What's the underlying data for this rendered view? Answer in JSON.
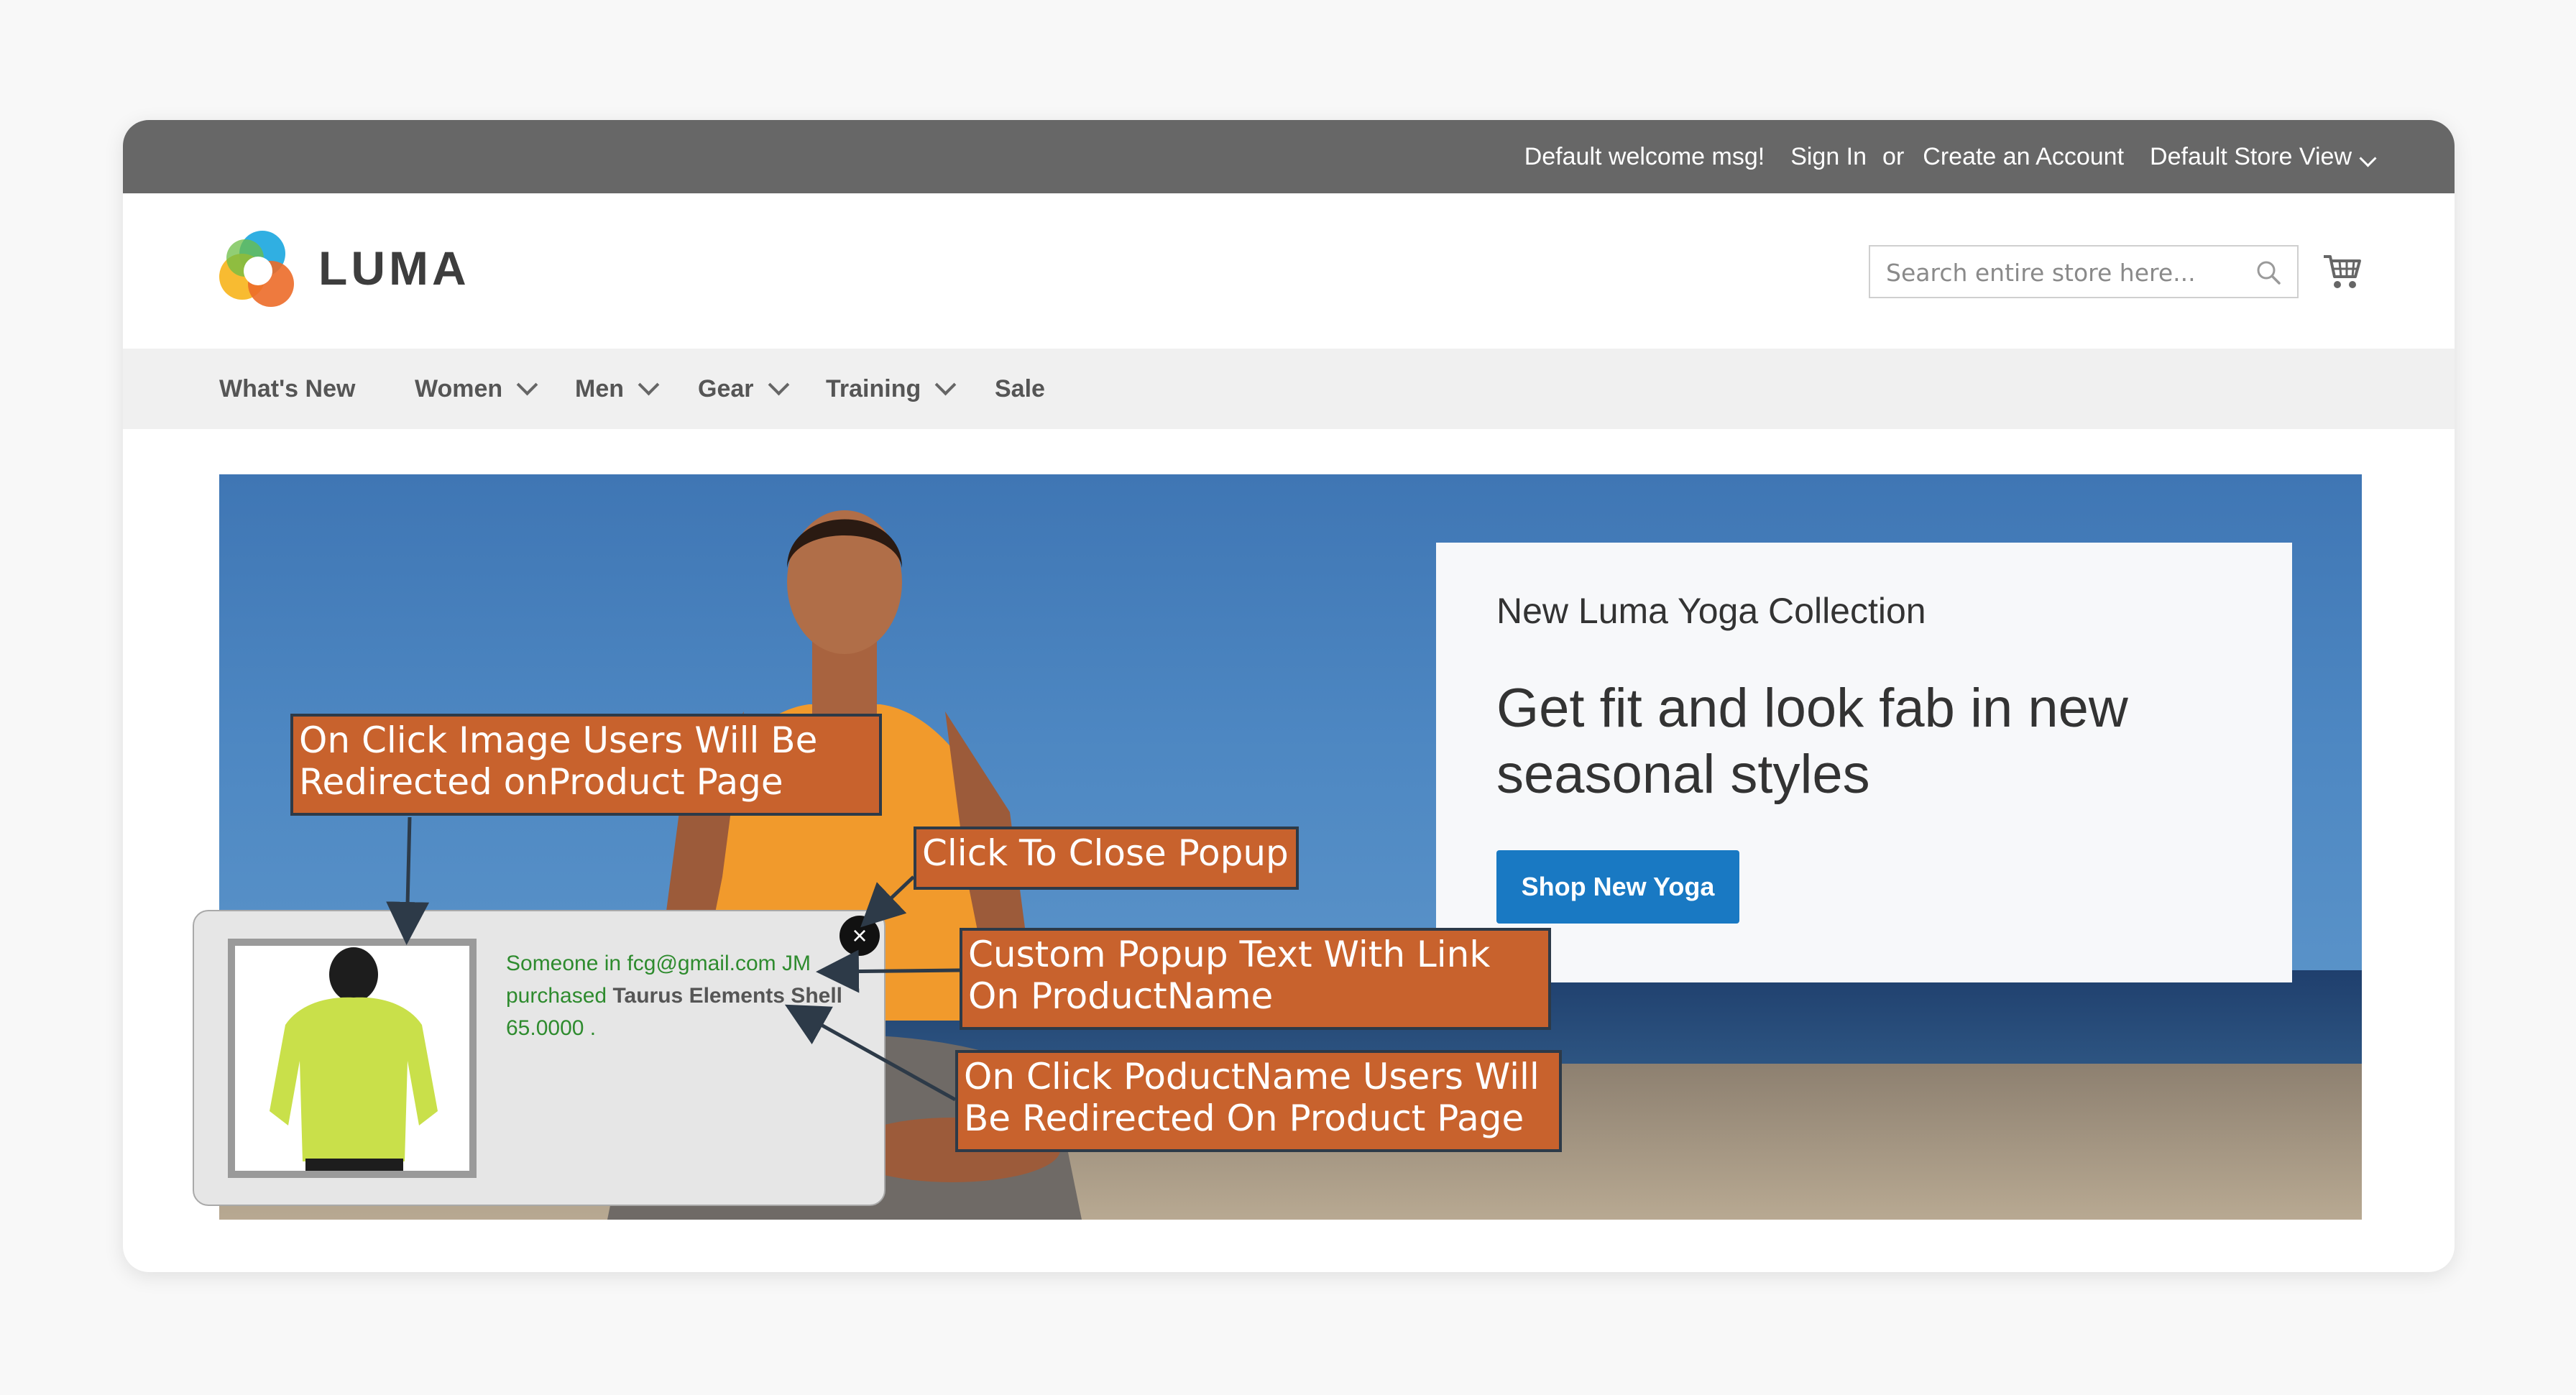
{
  "topbar": {
    "welcome": "Default welcome msg!",
    "sign_in": "Sign In",
    "or": "or",
    "create_account": "Create an Account",
    "store_view": "Default Store View"
  },
  "header": {
    "logo_text": "LUMA",
    "search_placeholder": "Search entire store here...",
    "icons": [
      "search-icon",
      "cart-icon"
    ]
  },
  "nav": {
    "items": [
      {
        "label": "What's New",
        "dropdown": false
      },
      {
        "label": "Women",
        "dropdown": true
      },
      {
        "label": "Men",
        "dropdown": true
      },
      {
        "label": "Gear",
        "dropdown": true
      },
      {
        "label": "Training",
        "dropdown": true
      },
      {
        "label": "Sale",
        "dropdown": false
      }
    ]
  },
  "hero": {
    "subtitle": "New Luma Yoga Collection",
    "title": "Get fit and look fab in new seasonal styles",
    "button": "Shop New Yoga"
  },
  "popup": {
    "line1": "Someone in fcg@gmail.com JM",
    "line2_prefix": "purchased",
    "product_name": "Taurus Elements Shell",
    "price": "65.0000 ."
  },
  "callouts": {
    "image": "On Click Image Users Will Be Redirected onProduct Page",
    "close": "Click To Close Popup",
    "text": "Custom Popup Text With Link On ProductName",
    "product": "On Click PoductName Users Will Be Redirected On Product Page"
  },
  "colors": {
    "topbar": "#676767",
    "nav_bg": "#f0f0f0",
    "button": "#1979c3",
    "callout": "#c8622d",
    "popup_text": "#2e8b2e"
  }
}
